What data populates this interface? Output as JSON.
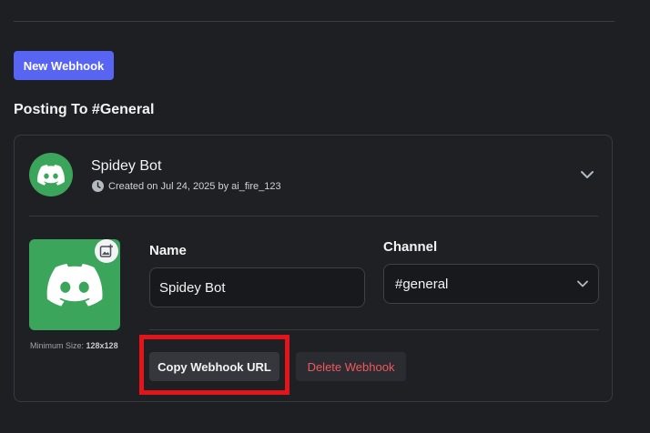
{
  "toolbar": {
    "new_webhook_label": "New Webhook"
  },
  "section": {
    "title": "Posting To #General"
  },
  "webhook": {
    "name": "Spidey Bot",
    "created_text": "Created on Jul 24, 2025 by ai_fire_123",
    "avatar_icon": "discord-logo-icon",
    "avatar_color": "#3ba55c",
    "min_size_label": "Minimum Size:",
    "min_size_value": "128x128"
  },
  "form": {
    "name_label": "Name",
    "name_value": "Spidey Bot",
    "channel_label": "Channel",
    "channel_value": "#general"
  },
  "actions": {
    "copy_url_label": "Copy Webhook URL",
    "delete_label": "Delete Webhook"
  },
  "colors": {
    "accent": "#5865f2",
    "danger": "#f0595b",
    "highlight": "#e3151b"
  }
}
